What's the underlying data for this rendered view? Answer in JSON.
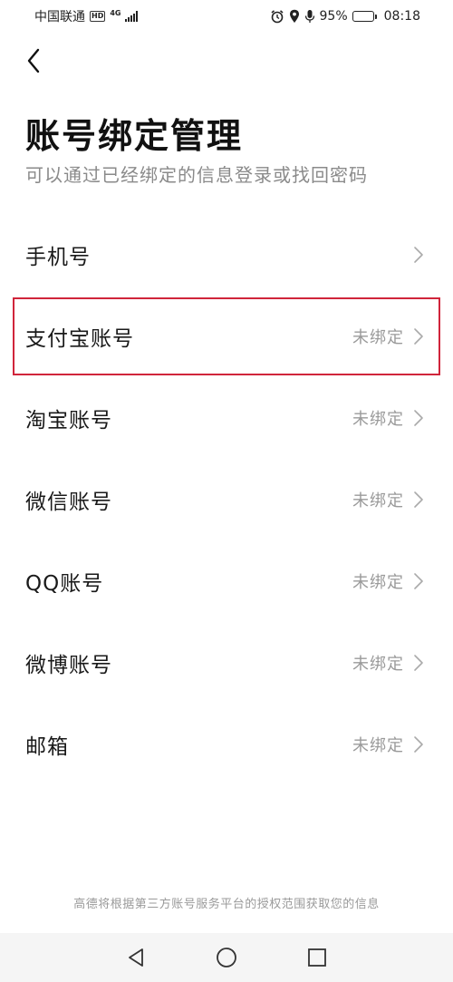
{
  "status_bar": {
    "carrier": "中国联通",
    "hd": "HD",
    "network": "4G",
    "battery": "95%",
    "battery_level": 0.95,
    "time": "08:18"
  },
  "header": {
    "title": "账号绑定管理",
    "subtitle": "可以通过已经绑定的信息登录或找回密码"
  },
  "bindings": [
    {
      "label": "手机号",
      "status": ""
    },
    {
      "label": "支付宝账号",
      "status": "未绑定"
    },
    {
      "label": "淘宝账号",
      "status": "未绑定"
    },
    {
      "label": "微信账号",
      "status": "未绑定"
    },
    {
      "label": "QQ账号",
      "status": "未绑定"
    },
    {
      "label": "微博账号",
      "status": "未绑定"
    },
    {
      "label": "邮箱",
      "status": "未绑定"
    }
  ],
  "footer": {
    "note": "高德将根据第三方账号服务平台的授权范围获取您的信息"
  },
  "colors": {
    "highlight": "#d0253b",
    "muted_text": "#9a9a9a",
    "nav_bg": "#f5f5f5"
  }
}
